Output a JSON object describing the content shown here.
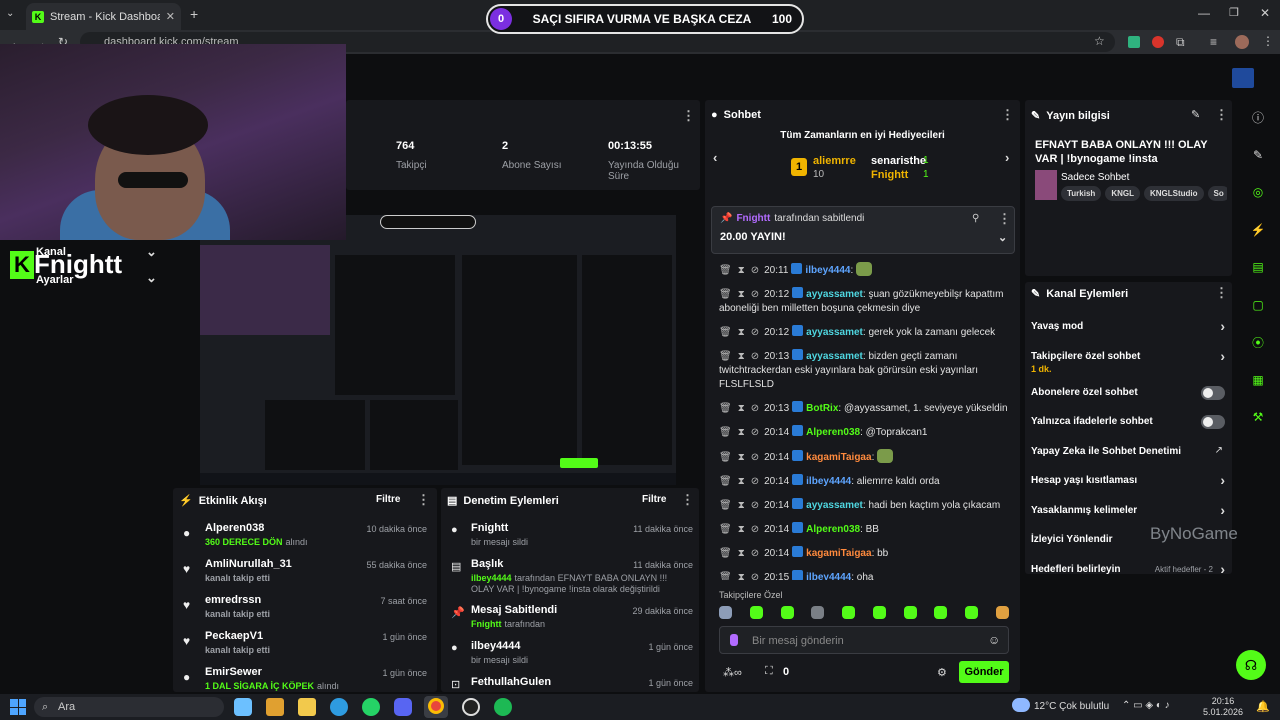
{
  "browser": {
    "tab_title": "Stream - Kick Dashboard",
    "url": "dashboard.kick.com/stream",
    "new_tab": "+",
    "favicon": "K"
  },
  "goal_bar": {
    "left": "0",
    "title": "SAÇI SIFIRA VURMA VE BAŞKA CEZA",
    "right": "100"
  },
  "stats": [
    {
      "value": "764",
      "label": "Takipçi"
    },
    {
      "value": "2",
      "label": "Abone Sayısı"
    },
    {
      "value": "00:13:55",
      "label": "Yayında Olduğu Süre"
    }
  ],
  "left_menu": {
    "channel_label": "Kanal",
    "settings_label": "Ayarlar",
    "streamer_name": "Fnightt"
  },
  "activity": {
    "title": "Etkinlik Akışı",
    "filter": "Filtre",
    "items": [
      {
        "name": "Alperen038",
        "sub": "360 DERECE DÖN",
        "sub2": "alındı",
        "time": "10 dakika önce",
        "sub_color": "#53fc18"
      },
      {
        "name": "AmliNurullah_31",
        "sub": "kanalı takip etti",
        "sub2": "",
        "time": "55 dakika önce",
        "sub_color": "#9da0a6"
      },
      {
        "name": "emredrssn",
        "sub": "kanalı takip etti",
        "sub2": "",
        "time": "7 saat önce",
        "sub_color": "#9da0a6"
      },
      {
        "name": "PeckaepV1",
        "sub": "kanalı takip etti",
        "sub2": "",
        "time": "1 gün önce",
        "sub_color": "#9da0a6"
      },
      {
        "name": "EmirSewer",
        "sub": "1 DAL SİGARA İÇ KÖPEK",
        "sub2": "alındı",
        "time": "1 gün önce",
        "sub_color": "#53fc18"
      }
    ]
  },
  "moderation": {
    "title": "Denetim Eylemleri",
    "filter": "Filtre",
    "items": [
      {
        "name": "Fnightt",
        "sub": "bir mesajı sildi",
        "time": "11 dakika önce"
      },
      {
        "name": "Başlık",
        "sub_user": "ilbey4444",
        "sub": "tarafından EFNAYT BABA ONLAYN !!! OLAY VAR | !bynogame !insta olarak değiştirildi",
        "time": "11 dakika önce"
      },
      {
        "name": "Mesaj Sabitlendi",
        "sub_user": "Fnightt",
        "sub": "tarafından",
        "time": "29 dakika önce"
      },
      {
        "name": "ilbey4444",
        "sub": "bir mesajı sildi",
        "time": "1 gün önce"
      },
      {
        "name": "FethullahGulen",
        "sub": "",
        "time": "1 gün önce"
      }
    ]
  },
  "chat": {
    "title": "Sohbet",
    "top_gifters_title": "Tüm Zamanların en iyi Hediyecileri",
    "gifters": [
      {
        "rank": "1",
        "name": "aliemrre",
        "count": "10"
      },
      {
        "name": "senaristhe",
        "count": "1"
      },
      {
        "name": "Fnightt",
        "count": "1"
      }
    ],
    "pinned_by": "Fnightt",
    "pinned_suffix": "tarafından sabitlendi",
    "pinned_message": "20.00 YAYIN!",
    "messages": [
      {
        "time": "20:11",
        "user": "ilbey4444",
        "color": "#5ea5ff",
        "text": "",
        "emote": true
      },
      {
        "time": "20:12",
        "user": "ayyassamet",
        "color": "#4fd6e0",
        "text": "şuan gözükmeyebilşr kapattım aboneliği ben milletten boşuna çekmesin diye"
      },
      {
        "time": "20:12",
        "user": "ayyassamet",
        "color": "#4fd6e0",
        "text": "gerek yok la zamanı gelecek"
      },
      {
        "time": "20:13",
        "user": "ayyassamet",
        "color": "#4fd6e0",
        "text": "bizden geçti zamanı twitchtrackerdan eski yayınlara bak görürsün eski yayınları FLSLFLSLD"
      },
      {
        "time": "20:13",
        "user": "BotRix",
        "color": "#53fc18",
        "text": "@ayyassamet, 1. seviyeye yükseldin"
      },
      {
        "time": "20:14",
        "user": "Alperen038",
        "color": "#53fc18",
        "text": "@Toprakcan1"
      },
      {
        "time": "20:14",
        "user": "kagamiTaigaa",
        "color": "#ff8a3d",
        "text": "",
        "emote": true
      },
      {
        "time": "20:14",
        "user": "ilbey4444",
        "color": "#5ea5ff",
        "text": "aliemrre kaldı orda"
      },
      {
        "time": "20:14",
        "user": "ayyassamet",
        "color": "#4fd6e0",
        "text": "hadi ben kaçtım yola çıkacam"
      },
      {
        "time": "20:14",
        "user": "Alperen038",
        "color": "#53fc18",
        "text": "BB"
      },
      {
        "time": "20:14",
        "user": "kagamiTaigaa",
        "color": "#ff8a3d",
        "text": "bb"
      },
      {
        "time": "20:15",
        "user": "ilbey4444",
        "color": "#5ea5ff",
        "text": "oha"
      }
    ],
    "followers_only_label": "Takipçilere Özel",
    "input_placeholder": "Bir mesaj gönderin",
    "points": "0",
    "send_label": "Gönder"
  },
  "stream_info": {
    "title": "Yayın bilgisi",
    "stream_title": "EFNAYT BABA ONLAYN !!! OLAY VAR | !bynogame !insta",
    "category": "Sadece Sohbet",
    "tags": [
      "Turkish",
      "KNGL",
      "KNGLStudio",
      "So"
    ]
  },
  "channel_actions": {
    "title": "Kanal Eylemleri",
    "items": [
      {
        "label": "Yavaş mod",
        "control": "chevron"
      },
      {
        "label": "Takipçilere özel sohbet",
        "sub": "1 dk.",
        "control": "chevron"
      },
      {
        "label": "Abonelere özel sohbet",
        "control": "toggle"
      },
      {
        "label": "Yalnızca ifadelerle sohbet",
        "control": "toggle"
      },
      {
        "label": "Yapay Zeka ile Sohbet Denetimi",
        "control": "external"
      },
      {
        "label": "Hesap yaşı kısıtlaması",
        "control": "chevron"
      },
      {
        "label": "Yasaklanmış kelimeler",
        "control": "chevron"
      },
      {
        "label": "İzleyici Yönlendir",
        "control": "none"
      },
      {
        "label": "Hedefleri belirleyin",
        "sub_right": "Aktif hedefler - 2",
        "control": "chevron"
      }
    ]
  },
  "watermark": "ByNoGame",
  "taskbar": {
    "search": "Ara",
    "weather": "12°C  Çok bulutlu",
    "time": "20:16",
    "date": "5.01.2026"
  },
  "colors": {
    "accent": "#53fc18",
    "background": "#0d0e10",
    "panel": "#17181c"
  }
}
